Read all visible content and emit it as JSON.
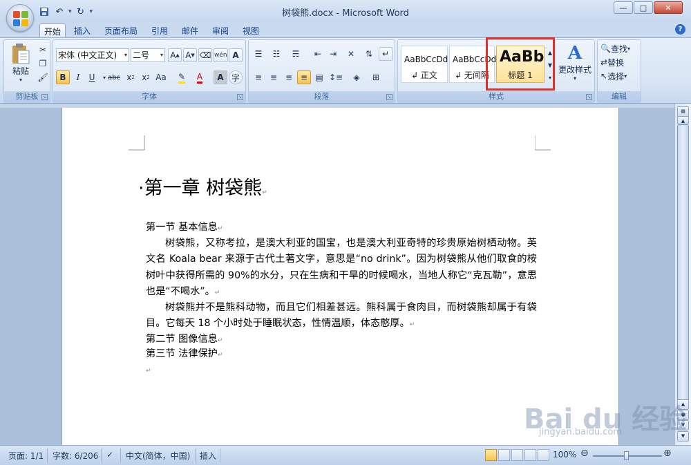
{
  "window": {
    "title": "树袋熊.docx - Microsoft Word",
    "controls": [
      "—",
      "□",
      "✕"
    ]
  },
  "qat": {
    "save_icon": "save-icon",
    "undo_icon": "undo-icon",
    "redo_icon": "redo-icon"
  },
  "tabs": [
    "开始",
    "插入",
    "页面布局",
    "引用",
    "邮件",
    "审阅",
    "视图"
  ],
  "ribbon": {
    "clipboard": {
      "label": "剪贴板",
      "paste": "粘贴"
    },
    "font": {
      "label": "字体",
      "font_name": "宋体 (中文正文)",
      "font_size": "二号"
    },
    "paragraph": {
      "label": "段落"
    },
    "styles": {
      "label": "样式",
      "items": [
        {
          "sample": "AaBbCcDdI",
          "name": "↲ 正文"
        },
        {
          "sample": "AaBbCcDdI",
          "name": "↲ 无间隔"
        },
        {
          "sample": "AaBb",
          "name": "标题 1"
        }
      ],
      "change_styles": "更改样式"
    },
    "editing": {
      "label": "编辑",
      "find": "查找",
      "replace": "替换",
      "select": "选择"
    }
  },
  "document": {
    "heading": "第一章  树袋熊",
    "lines": [
      "第一节  基本信息",
      "树袋熊，又称考拉，是澳大利亚的国宝，也是澳大利亚奇特的珍贵原始树栖动物。英文名 Koala bear 来源于古代土著文字，意思是“no drink”。因为树袋熊从他们取食的桉树叶中获得所需的 90%的水分，只在生病和干旱的时候喝水，当地人称它“克瓦勒”，意思也是“不喝水”。",
      "树袋熊并不是熊科动物，而且它们相差甚远。熊科属于食肉目，而树袋熊却属于有袋目。它每天 18 个小时处于睡眠状态，性情温顺，体态憨厚。",
      "第二节  图像信息",
      "第三节  法律保护"
    ]
  },
  "status": {
    "page": "页面: 1/1",
    "words": "字数: 6/206",
    "language": "中文(简体，中国)",
    "mode": "插入",
    "zoom": "100%"
  },
  "watermark": {
    "main": "Bai du 经验",
    "sub": "jingyan.baidu.com"
  }
}
